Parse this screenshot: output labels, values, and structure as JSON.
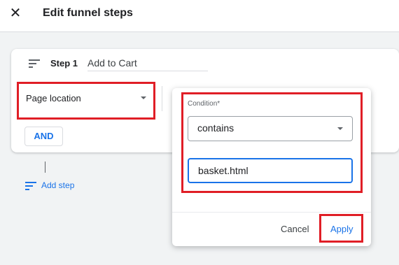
{
  "header": {
    "close_glyph": "✕",
    "title": "Edit funnel steps"
  },
  "step": {
    "number_label": "Step 1",
    "name": "Add to Cart",
    "dimension": "Page location",
    "and_label": "AND"
  },
  "popup": {
    "condition_label": "Condition*",
    "condition_value": "contains",
    "value": "basket.html",
    "cancel_label": "Cancel",
    "apply_label": "Apply"
  },
  "footer": {
    "add_step_label": "Add step"
  },
  "colors": {
    "highlight": "#e01e26",
    "accent": "#1a73e8"
  }
}
